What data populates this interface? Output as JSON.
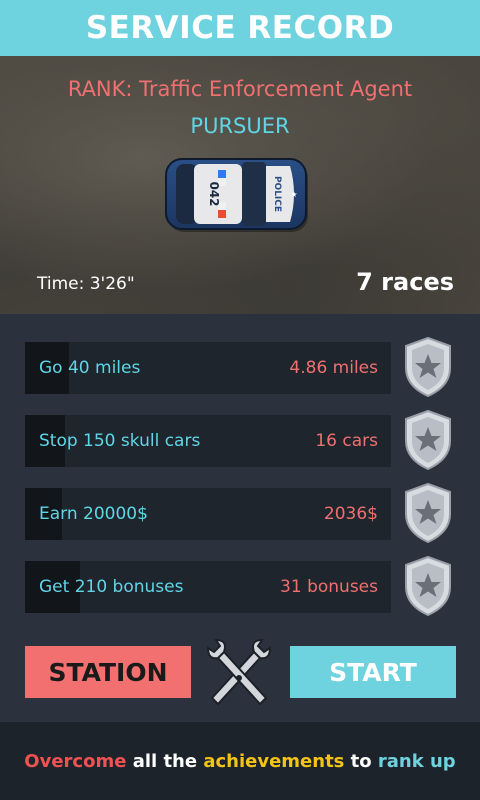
{
  "header": {
    "title": "SERVICE RECORD"
  },
  "hero": {
    "rank": "RANK: Traffic Enforcement Agent",
    "title": "PURSUER",
    "time": "Time: 3'26\"",
    "races": "7 races",
    "car": {
      "number": "042",
      "door_text": "POLICE"
    }
  },
  "achievements": [
    {
      "label": "Go 40 miles",
      "value": "4.86 miles",
      "progress": 0.12,
      "badge": "star-badge-icon"
    },
    {
      "label": "Stop 150 skull cars",
      "value": "16 cars",
      "progress": 0.11,
      "badge": "star-badge-icon"
    },
    {
      "label": "Earn 20000$",
      "value": "2036$",
      "progress": 0.1,
      "badge": "star-badge-icon"
    },
    {
      "label": "Get 210 bonuses",
      "value": "31 bonuses",
      "progress": 0.15,
      "badge": "star-badge-icon"
    }
  ],
  "buttons": {
    "station": "STATION",
    "start": "START"
  },
  "footer": {
    "part1": "Overcome",
    "part2": " all the ",
    "part3": "achievements",
    "part4": " to ",
    "part5": "rank up"
  },
  "colors": {
    "accent_cyan": "#6fd3df",
    "accent_red": "#f37070",
    "accent_yellow": "#f3c318",
    "panel_bg": "#2b323d"
  }
}
